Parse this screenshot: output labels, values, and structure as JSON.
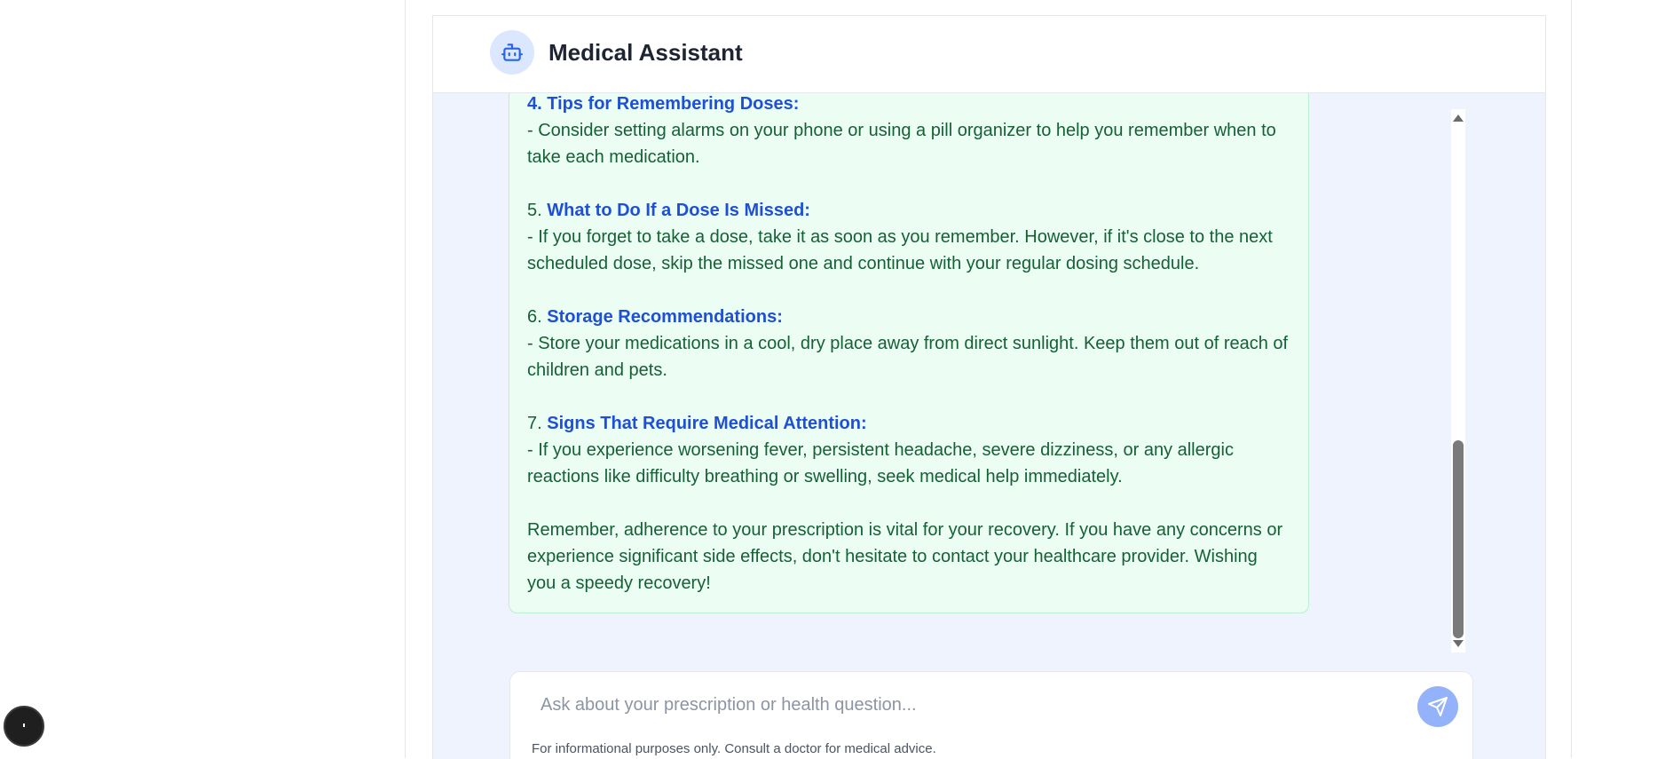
{
  "header": {
    "title": "Medical Assistant",
    "avatar_icon": "robot-icon"
  },
  "message": {
    "partial_top_heading": "4. Tips for Remembering Doses:",
    "sections": [
      {
        "number": "",
        "heading": "",
        "body": "- Consider setting alarms on your phone or using a pill organizer to help you remember when to take each medication."
      },
      {
        "number": "5.",
        "heading": "What to Do If a Dose Is Missed:",
        "body": "- If you forget to take a dose, take it as soon as you remember. However, if it's close to the next scheduled dose, skip the missed one and continue with your regular dosing schedule."
      },
      {
        "number": "6.",
        "heading": "Storage Recommendations:",
        "body": "- Store your medications in a cool, dry place away from direct sunlight. Keep them out of reach of children and pets."
      },
      {
        "number": "7.",
        "heading": "Signs That Require Medical Attention:",
        "body": "- If you experience worsening fever, persistent headache, severe dizziness, or any allergic reactions like difficulty breathing or swelling, seek medical help immediately."
      }
    ],
    "closing": "Remember, adherence to your prescription is vital for your recovery. If you have any concerns or experience significant side effects, don't hesitate to contact your healthcare provider. Wishing you a speedy recovery!"
  },
  "composer": {
    "placeholder": "Ask about your prescription or health question...",
    "value": "",
    "send_icon": "send-icon",
    "disclaimer": "For informational purposes only. Consult a doctor for medical advice."
  },
  "colors": {
    "accent": "#1d4fd8",
    "bubble_bg": "#ecfdf4",
    "bubble_text": "#166036",
    "send_button": "#93b2fa"
  }
}
